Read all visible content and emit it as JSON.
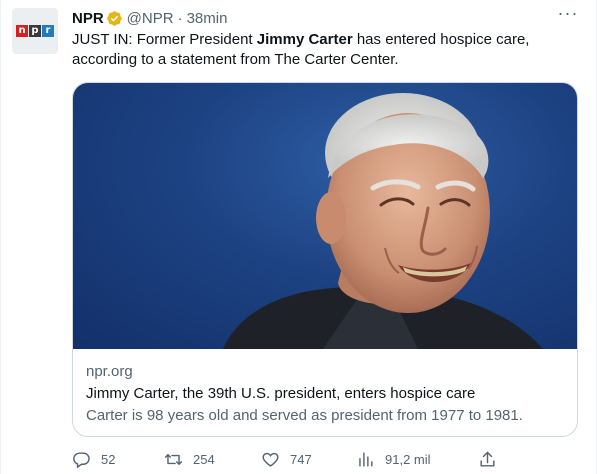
{
  "tweet": {
    "author_name": "NPR",
    "handle": "@NPR",
    "separator": "·",
    "time": "38min",
    "text_parts": {
      "before": "JUST IN: Former President ",
      "bold": "Jimmy Carter",
      "after": " has entered hospice care, according to a statement from The Carter Center."
    },
    "more_label": "···"
  },
  "avatar": {
    "logo_letters": [
      "n",
      "p",
      "r"
    ],
    "colors": [
      "#d62021",
      "#3a3a3a",
      "#237bbd"
    ]
  },
  "card": {
    "domain": "npr.org",
    "title": "Jimmy Carter, the 39th U.S. president, enters hospice care",
    "description": "Carter is 98 years old and served as president from 1977 to 1981."
  },
  "actions": {
    "replies": "52",
    "retweets": "254",
    "likes": "747",
    "views": "91,2 mil"
  },
  "colors": {
    "text": "#0f1419",
    "secondary": "#536471",
    "verified_gold": "#e2b719",
    "border": "#cfd9de"
  },
  "icons": {
    "verified": "verified-badge-icon",
    "more": "more-icon",
    "reply": "reply-icon",
    "retweet": "retweet-icon",
    "like": "heart-icon",
    "views": "views-icon",
    "share": "share-icon"
  }
}
